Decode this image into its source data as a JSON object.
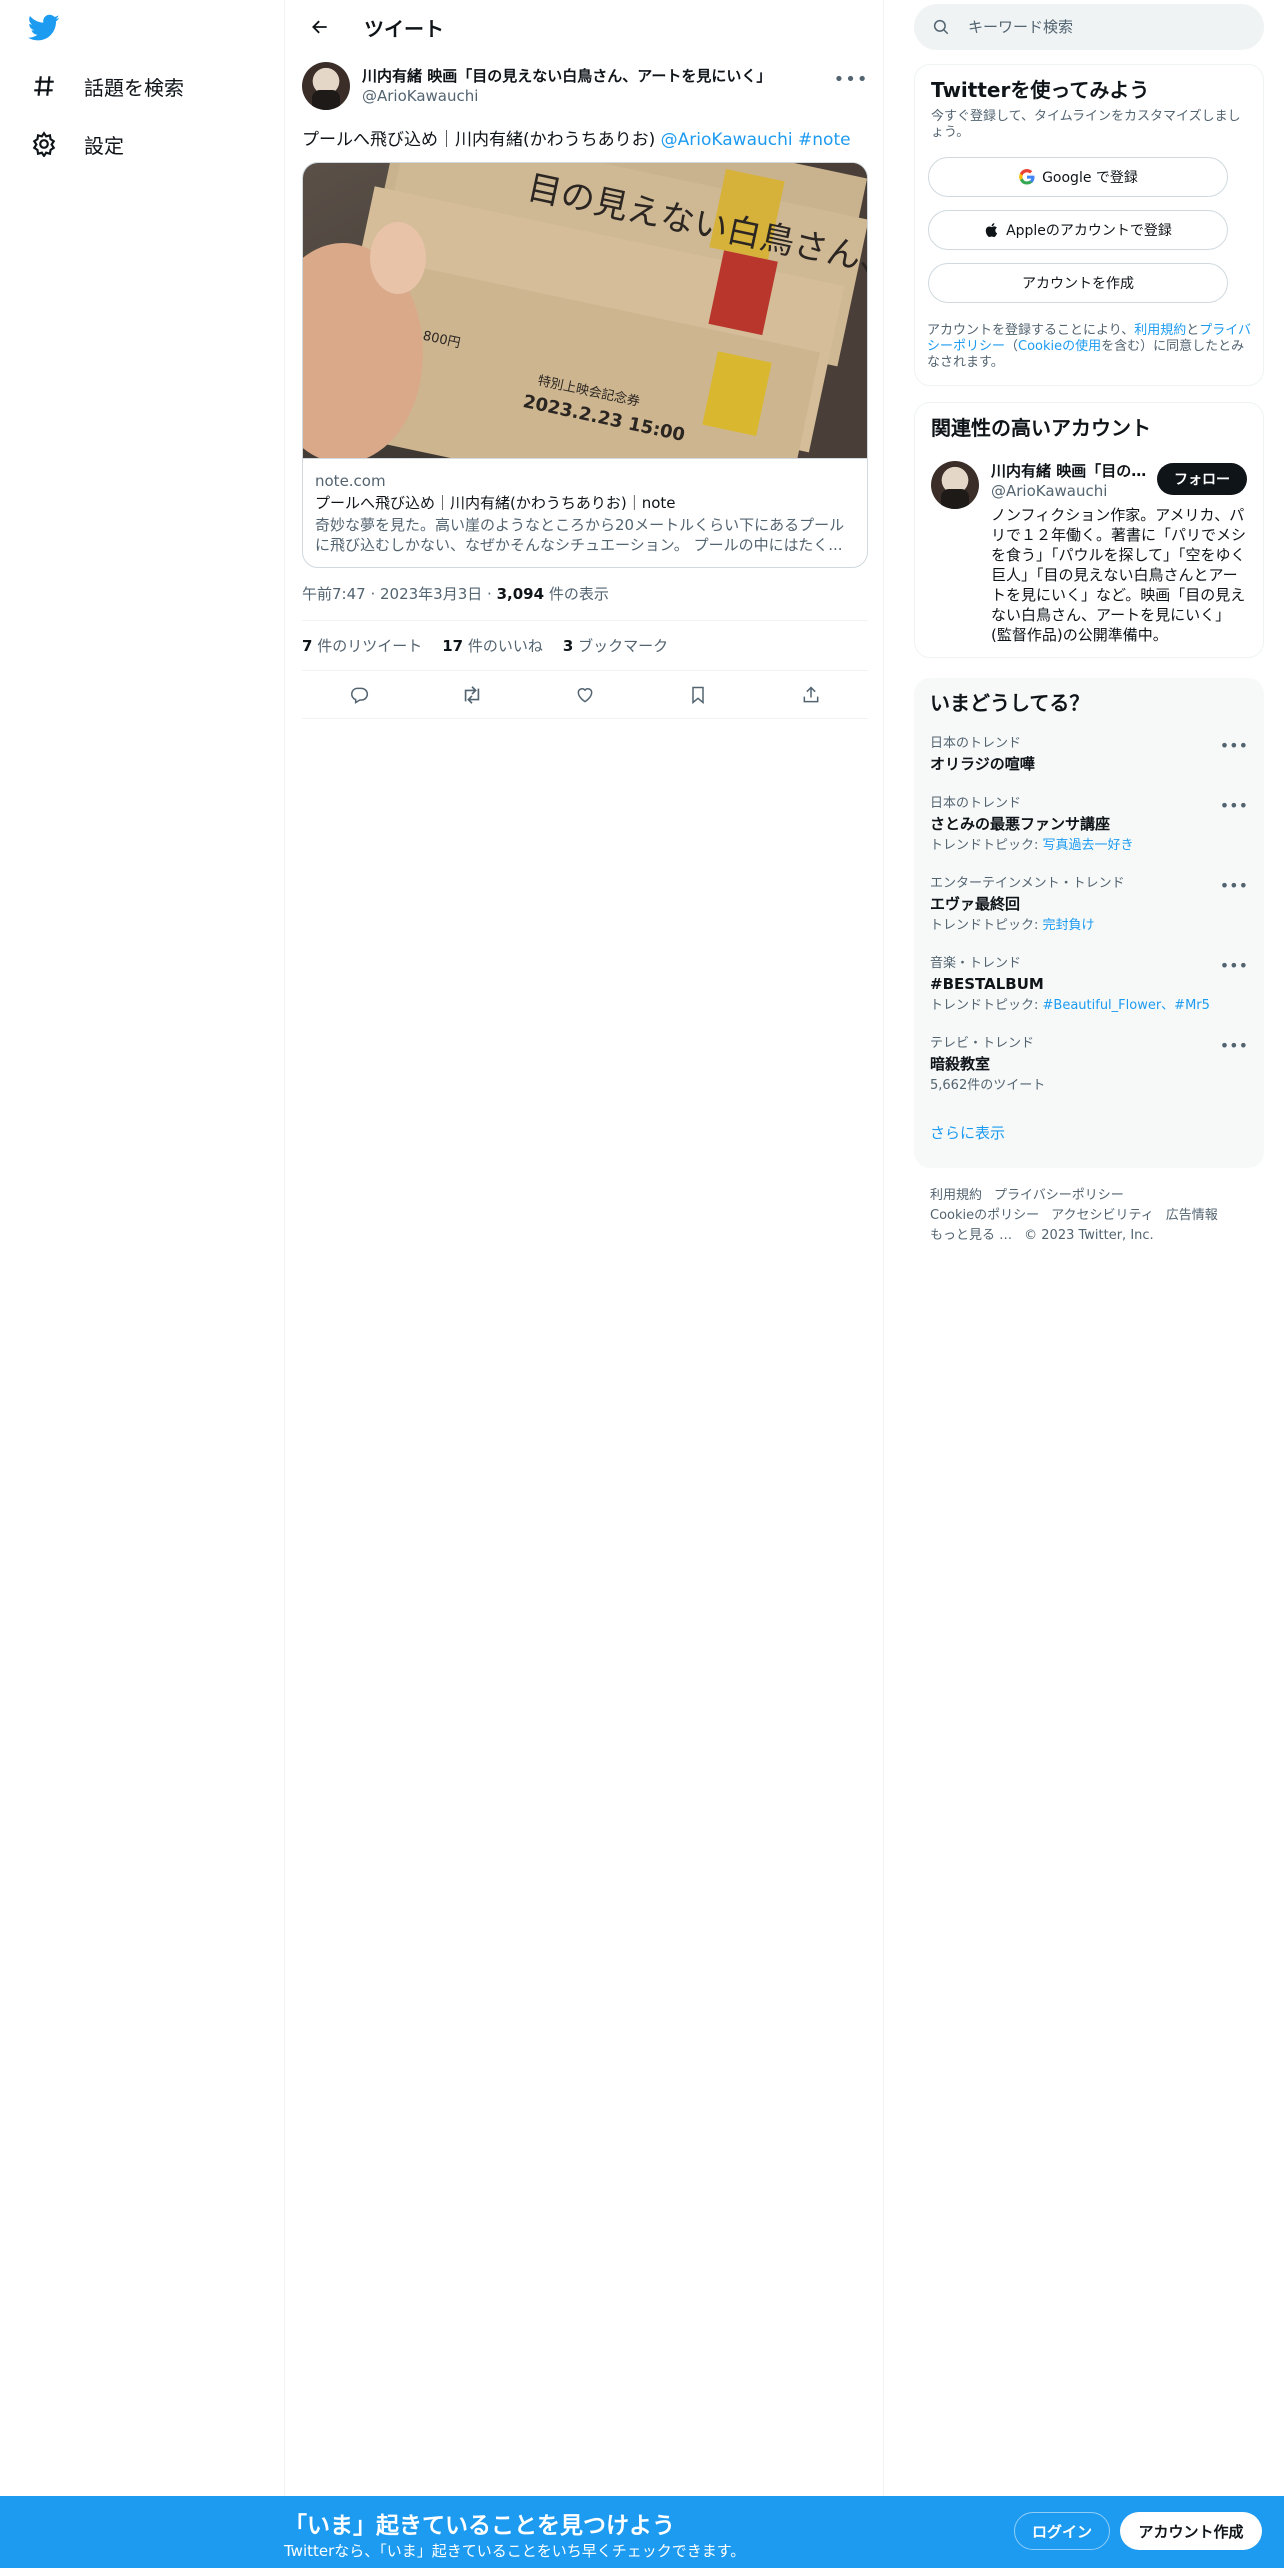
{
  "sidebar": {
    "items": [
      {
        "label": "話題を検索",
        "icon": "hashtag-icon"
      },
      {
        "label": "設定",
        "icon": "gear-icon"
      }
    ]
  },
  "header": {
    "title": "ツイート"
  },
  "tweet": {
    "author_name": "川内有緒 映画「目の見えない白鳥さん、アートを見にいく」",
    "author_handle": "@ArioKawauchi",
    "text": "プールへ飛び込め｜川内有緒(かわうちありお)",
    "mention": "@ArioKawauchi",
    "hashtag": "#note",
    "card": {
      "domain": "note.com",
      "title": "プールへ飛び込め｜川内有緒(かわうちありお)｜note",
      "description": "奇妙な夢を見た。高い崖のようなところから20メートルくらい下にあるプールに飛び込むしかない、なぜかそんなシチュエーション。 プールの中にはたく...",
      "image_texts": [
        "目の見えない白鳥さん、アートを見にいく",
        "一般 1800円",
        "特別上映会記念券",
        "2023.2.23 15:00"
      ]
    },
    "time": "午前7:47",
    "date": "2023年3月3日",
    "views_count": "3,094",
    "views_label": "件の表示",
    "retweets_count": "7",
    "retweets_label": "件のリツイート",
    "likes_count": "17",
    "likes_label": "件のいいね",
    "bookmarks_count": "3",
    "bookmarks_label": "ブックマーク"
  },
  "search": {
    "placeholder": "キーワード検索"
  },
  "signup": {
    "title": "Twitterを使ってみよう",
    "subtitle": "今すぐ登録して、タイムラインをカスタマイズしましょう。",
    "google_label": "Google で登録",
    "apple_label": "Appleのアカウントで登録",
    "create_label": "アカウントを作成",
    "fine_1": "アカウントを登録することにより、",
    "fine_terms": "利用規約",
    "fine_2": "と",
    "fine_privacy": "プライバシーポリシー",
    "fine_3": "（",
    "fine_cookie": "Cookieの使用",
    "fine_4": "を含む）に同意したとみなされます。"
  },
  "related": {
    "title": "関連性の高いアカウント",
    "name": "川内有緒 映画「目の見えない白鳥さん、アートを見にいく」",
    "handle": "@ArioKawauchi",
    "follow_label": "フォロー",
    "bio": "ノンフィクション作家。アメリカ、パリで１２年働く。著書に「パリでメシを食う」「パウルを探して」「空をゆく巨人」「目の見えない白鳥さんとアートを見にいく」など。映画「目の見えない白鳥さん、アートを見にいく」(監督作品)の公開準備中。"
  },
  "trends": {
    "title": "いまどうしてる？",
    "items": [
      {
        "context": "日本のトレンド",
        "name": "オリラジの喧嘩",
        "sub_prefix": "",
        "sub_link": ""
      },
      {
        "context": "日本のトレンド",
        "name": "さとみの最悪ファンサ講座",
        "sub_prefix": "トレンドトピック: ",
        "sub_link": "写真過去一好き"
      },
      {
        "context": "エンターテインメント・トレンド",
        "name": "エヴァ最終回",
        "sub_prefix": "トレンドトピック: ",
        "sub_link": "完封負け"
      },
      {
        "context": "音楽・トレンド",
        "name": "#BESTALBUM",
        "sub_prefix": "トレンドトピック: ",
        "sub_link": "#Beautiful_Flower、#Mr5"
      },
      {
        "context": "テレビ・トレンド",
        "name": "暗殺教室",
        "sub_prefix": "5,662件のツイート",
        "sub_link": ""
      }
    ],
    "show_more": "さらに表示"
  },
  "footer": {
    "terms": "利用規約",
    "privacy": "プライバシーポリシー",
    "cookie": "Cookieのポリシー",
    "accessibility": "アクセシビリティ",
    "ads": "広告情報",
    "more": "もっと見る …",
    "copyright": "© 2023 Twitter, Inc."
  },
  "bottom": {
    "title": "「いま」起きていることを見つけよう",
    "subtitle": "Twitterなら、「いま」起きていることをいち早くチェックできます。",
    "login": "ログイン",
    "create": "アカウント作成"
  },
  "colors": {
    "accent": "#1d9bf0",
    "text": "#0f1419",
    "muted": "#536471"
  }
}
